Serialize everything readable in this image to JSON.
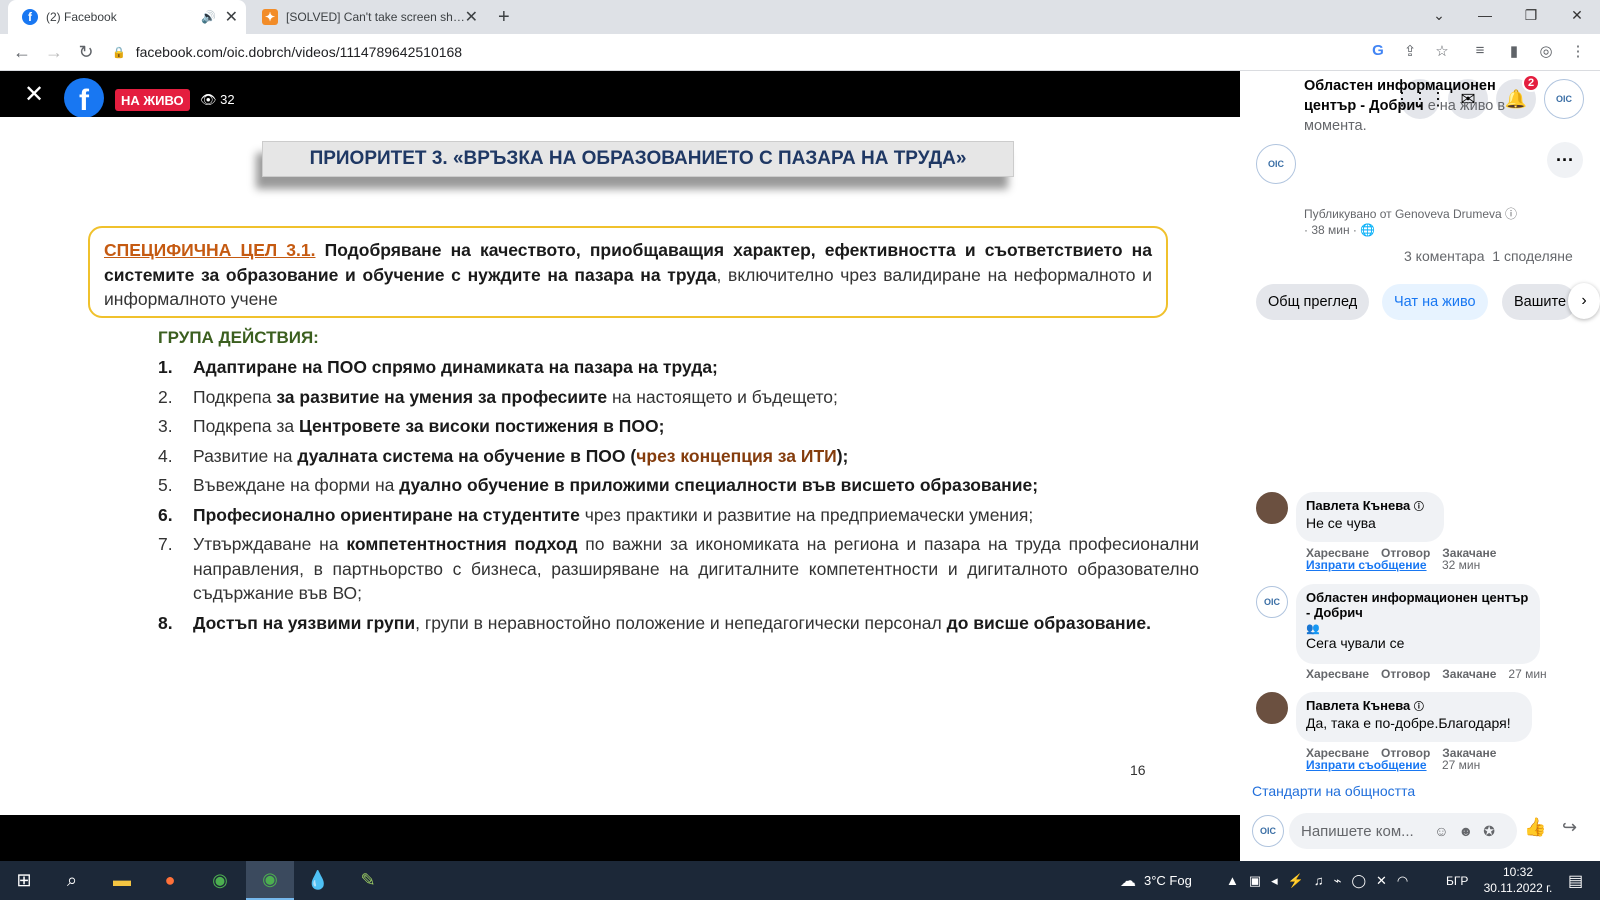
{
  "browser": {
    "tabs": [
      {
        "title": "(2) Facebook",
        "favicon": "f",
        "active": true
      },
      {
        "title": "[SOLVED] Can't take screen shot...",
        "active": false
      }
    ],
    "url": "facebook.com/oic.dobrch/videos/1114789642510168"
  },
  "video": {
    "live_label": "НА ЖИВО",
    "viewers": "32",
    "slide": {
      "title": "ПРИОРИТЕТ 3.  «ВРЪЗКА НА ОБРАЗОВАНИЕТО С ПАЗАРА НА ТРУДА»",
      "goal_label": "СПЕЦИФИЧНА ЦЕЛ 3.1.",
      "goal_bold": "Подобряване на качеството, приобщаващия характер, ефективността и съответствието на системите за образование и обучение с нуждите на пазара на труда",
      "goal_rest": ", включително чрез валидиране на неформалното и информалното учене",
      "group_title": "ГРУПА ДЕЙСТВИЯ:",
      "actions": [
        {
          "num": "1.",
          "a": "",
          "b": "Адаптиране на ПОО спрямо динамиката на пазара на труда;",
          "c": ""
        },
        {
          "num": "2.",
          "a": "Подкрепа ",
          "b": "за развитие на умения за професиите",
          "c": " на настоящето и бъдещето;"
        },
        {
          "num": "3.",
          "a": "Подкрепа за ",
          "b": "Центровете за високи постижения в ПОО;",
          "c": ""
        },
        {
          "num": "4.",
          "a": "Развитие на ",
          "b": "дуалната система на обучение в ПОО (",
          "brown": "чрез концепция за ИТИ",
          "end": ");"
        },
        {
          "num": "5.",
          "a": "Въвеждане на форми на ",
          "b": "дуално обучение в приложими специалности във висшето образование;",
          "c": ""
        },
        {
          "num": "6.",
          "a": "",
          "b": "Професионално ориентиране на студентите",
          "c": " чрез практики и развитие на предприемачески умения;"
        },
        {
          "num": "7.",
          "a": "Утвърждаване на ",
          "b": "компетентностния подход",
          "c": " по важни за икономиката на региона и пазара на труда професионални направления, в партньорство с бизнеса, разширяване на дигиталните компетентности и дигиталното образователно съдържание във ВО;"
        },
        {
          "num": "8.",
          "a": "",
          "b": "Достъп на уязвими групи",
          "c": ", групи в неравностойно положение и непедагогически персонал ",
          "b2": "до висше образование."
        }
      ],
      "page_number": "16"
    }
  },
  "panel": {
    "notifications_count": "2",
    "page_name": "Областен информационен център - Добрич",
    "page_status": " е на живо в момента.",
    "posted_by": "Публикувано от Genoveva Drumeva",
    "posted_time": "· 38 мин ·",
    "comments_count": "3 коментара",
    "shares_count": "1 споделяне",
    "tabs": [
      "Общ преглед",
      "Чат на живо",
      "Вашите"
    ],
    "comments": [
      {
        "author": "Павлета Кънева",
        "text": "Не се чува",
        "like": "Харесване",
        "reply": "Отговор",
        "pin": "Закачане",
        "send": "Изпрати съобщение",
        "time": "32 мин"
      },
      {
        "author": "Областен информационен център - Добрич",
        "text": "Сега чували се",
        "like": "Харесване",
        "reply": "Отговор",
        "pin": "Закачане",
        "time": "27 мин"
      },
      {
        "author": "Павлета Кънева",
        "text": "Да, така е по-добре.Благодаря!",
        "like": "Харесване",
        "reply": "Отговор",
        "pin": "Закачане",
        "send": "Изпрати съобщение",
        "time": "27 мин"
      }
    ],
    "community_standards": "Стандарти на общността",
    "comment_placeholder": "Напишете ком..."
  },
  "taskbar": {
    "weather": "3°C  Fog",
    "language": "БГР",
    "time": "10:32",
    "date": "30.11.2022 г."
  }
}
